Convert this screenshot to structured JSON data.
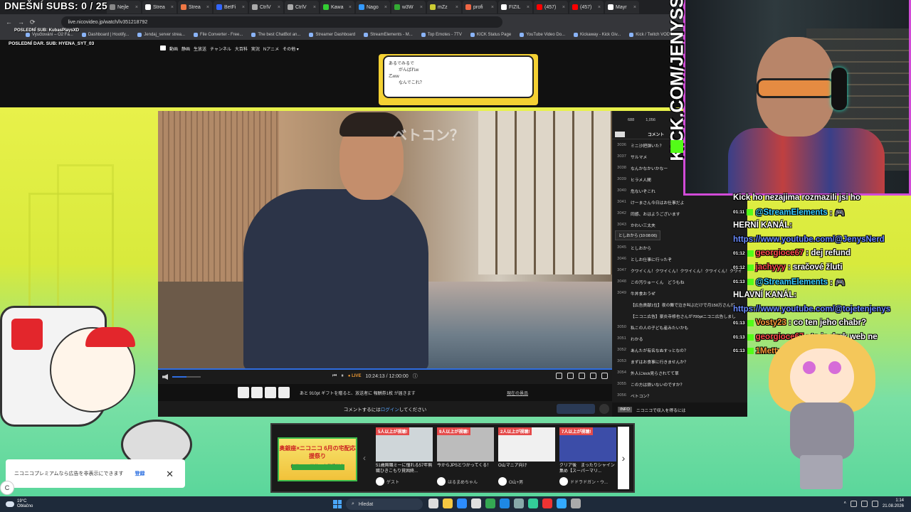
{
  "overlay": {
    "subs_title": "DNEŠNÍ SUBS: 0 / 25",
    "last_sub": "POSLEDNÍ SUB: KubasPlaysXD",
    "last_donation": "POSLEDNÍ DAR. SUB: HYENA_SYT_03",
    "kick_vertical": "KICK.COM/JENYSS"
  },
  "browser": {
    "tabs": [
      {
        "label": "Nejle",
        "color": "#888"
      },
      {
        "label": "Strea",
        "color": "#fff"
      },
      {
        "label": "Strea",
        "color": "#e74"
      },
      {
        "label": "BetFi",
        "color": "#36f"
      },
      {
        "label": "CtrlV",
        "color": "#aaa"
      },
      {
        "label": "CtrlV",
        "color": "#aaa"
      },
      {
        "label": "Kawa",
        "color": "#3c3"
      },
      {
        "label": "Nago",
        "color": "#39f"
      },
      {
        "label": "w3W",
        "color": "#3a3"
      },
      {
        "label": "mZz",
        "color": "#cc3"
      },
      {
        "label": "profi",
        "color": "#e64"
      },
      {
        "label": "FIZIL",
        "color": "#fff"
      },
      {
        "label": "(457)",
        "color": "#f00"
      },
      {
        "label": "(457)",
        "color": "#f00"
      },
      {
        "label": "Mayr",
        "color": "#fff"
      }
    ],
    "url": "live.nicovideo.jp/watch/lv351218792",
    "bookmarks": [
      "Vyučtování – O2 Fa...",
      "Dashboard | Hootify...",
      "Jendaj_server strea...",
      "File Converter - Free...",
      "The best ChatBot an...",
      "Streamer Dashboard",
      "StreamElements - M...",
      "Top Emotes - 7TV",
      "KICK Status Page",
      "YouTube Video Do...",
      "Kickaway - Kick Giv...",
      "Kick / Twitch VOD d..."
    ]
  },
  "nico_nav": [
    "動画",
    "静画",
    "生放送",
    "チャンネル",
    "大百科",
    "実況",
    "Nアニメ",
    "その他 ▾"
  ],
  "top_thumb_text": [
    "あるでみるで",
    "がんばれw",
    "乙ww",
    "なんでこれ？"
  ],
  "player": {
    "overlay_text": "ベトコン？",
    "live_label": "● LIVE",
    "time": "10:24:13 / 12:00:00"
  },
  "gift": {
    "text": "あと 910pt ギフトを贈ると、放送者に 報酬券1枚 が届きます",
    "link": "現在の景品"
  },
  "comment_bar": {
    "prefix": "コメントするには",
    "login": "ログイン",
    "suffix": "してください"
  },
  "comment_panel": {
    "viewers": "688",
    "comments": "1,056",
    "tab_label": "コメント",
    "tooltip": "としおから (10:08:06)",
    "rows": [
      {
        "n": "3036",
        "t": "ミニ沙把弾いた？"
      },
      {
        "n": "3037",
        "t": "サルマメ"
      },
      {
        "n": "3038",
        "t": "なんかなかいかなー"
      },
      {
        "n": "3039",
        "t": "ヒラメ人間"
      },
      {
        "n": "3040",
        "t": "危ないぞこれ"
      },
      {
        "n": "3041",
        "t": "けーまさん今日はお仕事だよ"
      },
      {
        "n": "3042",
        "t": "同感、おはようございます"
      },
      {
        "n": "3043",
        "t": "かわい三太夫"
      },
      {
        "n": "3044",
        "t": "になれる？"
      },
      {
        "n": "3045",
        "t": "としおから"
      },
      {
        "n": "3046",
        "t": "としお仕事に行ったぞ"
      },
      {
        "n": "3047",
        "t": "クワイくん！クワイくん！クワイくん！クワイくん！クワイ"
      },
      {
        "n": "3048",
        "t": "この汚りゅーくん　どうもね"
      },
      {
        "n": "3049",
        "t": "牛丼食おうぜ"
      },
      {
        "n": "",
        "t": "【広告貢献1位】夜の舞で泣き叫ぶだけで月150万さんが"
      },
      {
        "n": "",
        "t": "【ニコニ広告】豪炎寺修也さんが700ptニコニ広告しまし"
      },
      {
        "n": "3050",
        "t": "私この人の子ども産みたいかも"
      },
      {
        "n": "3051",
        "t": "わかる"
      },
      {
        "n": "3052",
        "t": "あんたが有名なぬすっとなの？"
      },
      {
        "n": "3053",
        "t": "まずはお食事に行きませんか？"
      },
      {
        "n": "3054",
        "t": "外人にkick見らされてて草"
      },
      {
        "n": "3055",
        "t": "この方は鉄いないのですか？"
      },
      {
        "n": "3056",
        "t": "ベトコン？"
      }
    ],
    "footer_badge": "INFO",
    "footer_text": "ニコニコで収入を得るには"
  },
  "chat": {
    "lines": [
      {
        "time": "",
        "user": "",
        "text": "Kick ho nezajima rozmazili jsi ho",
        "kind": "plain"
      },
      {
        "time": "01:11",
        "user": "@StreamElements",
        "text": ": 🎮",
        "kind": "se"
      },
      {
        "time": "",
        "user": "",
        "text": "HERNÍ KANÁL:",
        "kind": "plain"
      },
      {
        "time": "",
        "user": "",
        "text": "https://www.youtube.com/@JenysNerd",
        "kind": "link"
      },
      {
        "time": "01:12",
        "user": "georgioce67",
        "text": ": dej refund",
        "kind": "red"
      },
      {
        "time": "01:12",
        "user": "jachyyy",
        "text": ": sračové žluti",
        "kind": "red"
      },
      {
        "time": "01:13",
        "user": "@StreamElements",
        "text": ": 🎮",
        "kind": "se"
      },
      {
        "time": "",
        "user": "",
        "text": "HLAVNÍ KANÁL:",
        "kind": "plain"
      },
      {
        "time": "",
        "user": "",
        "text": "https://www.youtube.com/@tojetenjenys",
        "kind": "link"
      },
      {
        "time": "01:13",
        "user": "Vosty23",
        "text": ": co ten jeho chabr?",
        "kind": "orange"
      },
      {
        "time": "01:13",
        "user": "georgioce67",
        "text": ": to je dark web ne",
        "kind": "red"
      },
      {
        "time": "01:13",
        "user": "1Metty",
        "text": ": klikni na to live",
        "kind": "orange"
      }
    ]
  },
  "premium_banner": {
    "text": "ニコニコプレミアムなら広告を非表示にできます",
    "register": "登録",
    "close": "✕"
  },
  "recommendations": {
    "ad_text": "奥銀座×ニコニコ 6月の宅配応援祭り",
    "ad_sub": "毎日3,000円分の応募受付中",
    "cards": [
      {
        "viewers": "5人以上が視聴!",
        "title": "51歳無職ミーに憧れる57年無職ひきこもり貧困終...",
        "channel": "ゲスト",
        "color": "#cfd6d9"
      },
      {
        "viewers": "9人以上が視聴!",
        "title": "今からJPSとつかってくる！",
        "channel": "はるまめちゃん",
        "color": "#bcbcbc"
      },
      {
        "viewers": "2人以上が視聴!",
        "title": "O山マニア向け",
        "channel": "O山+男",
        "color": "#f0f0f0"
      },
      {
        "viewers": "7人以上が視聴!",
        "title": "クリア後　まったりシャイン集め【スーパーマリ...",
        "channel": "ドドラドガン・ウ...",
        "color": "#3c4da8"
      }
    ]
  },
  "taskbar": {
    "temp": "19°C",
    "weather": "Oblačno",
    "search": "Hledat",
    "time": "1:14",
    "date": "21.08.2026",
    "icon_colors": [
      "#ddd",
      "#f5c842",
      "#2d8cff",
      "#e0e0e0",
      "#34a853",
      "#1e88e5",
      "#8aa",
      "#3c9",
      "#e33",
      "#3af",
      "#aaa"
    ]
  }
}
